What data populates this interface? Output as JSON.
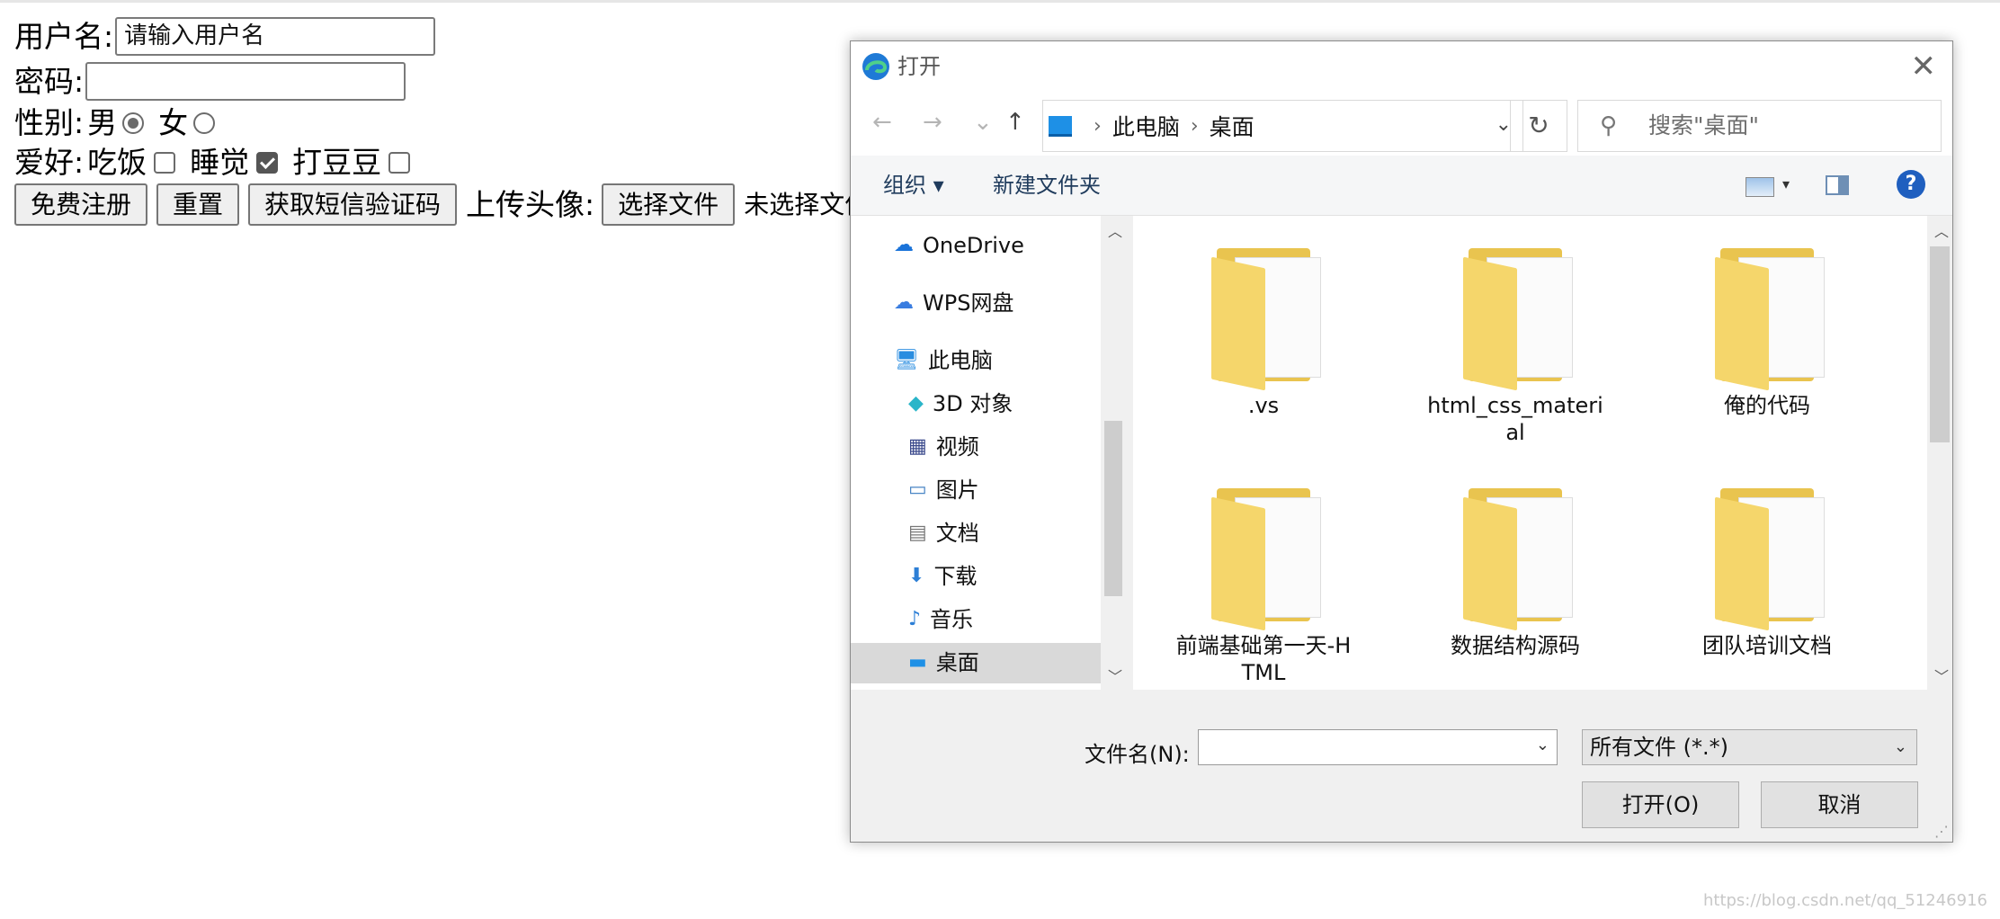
{
  "form": {
    "username_label": "用户名:",
    "username_placeholder": "请输入用户名",
    "password_label": "密码:",
    "gender_label": "性别:",
    "gender_male": "男",
    "gender_female": "女",
    "gender_selected": "男",
    "hobby_label": "爱好:",
    "hobbies": [
      {
        "label": "吃饭",
        "checked": false
      },
      {
        "label": "睡觉",
        "checked": true
      },
      {
        "label": "打豆豆",
        "checked": false
      }
    ],
    "register_button": "免费注册",
    "reset_button": "重置",
    "sms_button": "获取短信验证码",
    "avatar_label": "上传头像:",
    "choose_file_button": "选择文件",
    "no_file_text": "未选择文件"
  },
  "dialog": {
    "title": "打开",
    "close_glyph": "✕",
    "nav": {
      "back": "←",
      "forward": "→",
      "recent": "⌄",
      "up": "↑"
    },
    "breadcrumb": [
      "此电脑",
      "桌面"
    ],
    "refresh_glyph": "↻",
    "search_placeholder": "搜索\"桌面\"",
    "commands": {
      "organize": "组织 ▾",
      "new_folder": "新建文件夹"
    },
    "help_glyph": "?",
    "nav_items": [
      {
        "label": "OneDrive",
        "icon": "cloud-icon"
      },
      {
        "label": "WPS网盘",
        "icon": "cloud-icon"
      },
      {
        "label": "此电脑",
        "icon": "computer-icon"
      },
      {
        "label": "3D 对象",
        "icon": "cube-icon"
      },
      {
        "label": "视频",
        "icon": "film-icon"
      },
      {
        "label": "图片",
        "icon": "picture-icon"
      },
      {
        "label": "文档",
        "icon": "document-icon"
      },
      {
        "label": "下载",
        "icon": "download-icon"
      },
      {
        "label": "音乐",
        "icon": "music-icon"
      },
      {
        "label": "桌面",
        "icon": "desktop-icon"
      }
    ],
    "selected_nav": "桌面",
    "files": [
      {
        "name": ".vs"
      },
      {
        "name": "html_css_material"
      },
      {
        "name": "俺的代码"
      },
      {
        "name": "前端基础第一天-HTML"
      },
      {
        "name": "数据结构源码"
      },
      {
        "name": "团队培训文档"
      }
    ],
    "filename_label": "文件名(N):",
    "filename_value": "",
    "filter_value": "所有文件 (*.*)",
    "open_button": "打开(O)",
    "cancel_button": "取消"
  },
  "watermark": "https://blog.csdn.net/qq_51246916",
  "colors": {
    "folder": "#f5d66b",
    "help_blue": "#1f5fbf",
    "pc_blue": "#1e90e6"
  }
}
